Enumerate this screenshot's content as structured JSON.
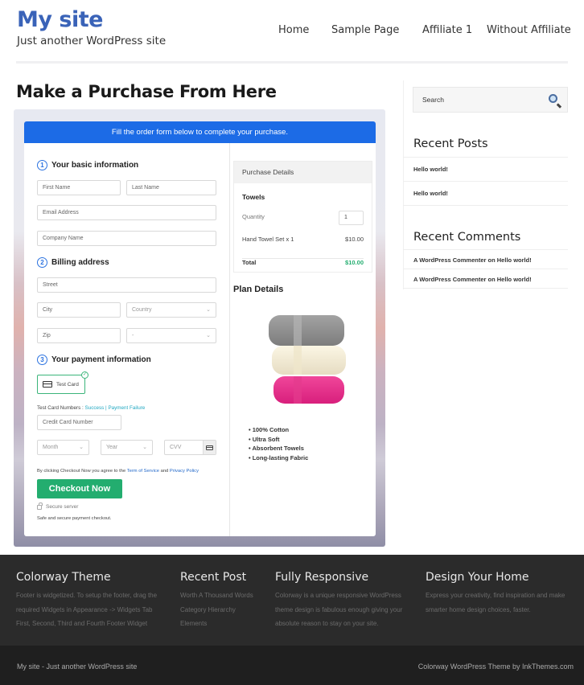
{
  "header": {
    "site_title": "My site",
    "tagline": "Just another WordPress site",
    "nav": [
      "Home",
      "Sample Page",
      "Affiliate 1",
      "Without Affiliate"
    ]
  },
  "page": {
    "title": "Make a Purchase From Here"
  },
  "form": {
    "banner": "Fill the order form below to complete your purchase.",
    "steps": [
      {
        "num": "1",
        "label": "Your basic information"
      },
      {
        "num": "2",
        "label": "Billing address"
      },
      {
        "num": "3",
        "label": "Your payment information"
      }
    ],
    "placeholders": {
      "first_name": "First Name",
      "last_name": "Last Name",
      "email": "Email Address",
      "company": "Company Name",
      "street": "Street",
      "city": "City",
      "country": "Country",
      "zip": "Zip",
      "state": "-",
      "card_number": "Credit Card Number",
      "month": "Month",
      "year": "Year",
      "cvv": "CVV"
    },
    "payment_method": "Test Card",
    "test_cards_label": "Test Card Numbers : ",
    "test_success": "Success",
    "test_sep": " | ",
    "test_failure": "Payment Failure",
    "agree_prefix": "By clicking Checkout Now you agree to the ",
    "terms_link": "Term of Service",
    "agree_and": " and ",
    "privacy_link": "Privacy Policy",
    "checkout_button": "Checkout Now",
    "secure_server": "Secure server",
    "safe_text": "Safe and secure payment checkout."
  },
  "purchase": {
    "header": "Purchase Details",
    "product": "Towels",
    "quantity_label": "Quantity",
    "quantity_value": "1",
    "line_item": "Hand Towel Set x 1",
    "line_price": "$10.00",
    "total_label": "Total",
    "total_value": "$10.00",
    "total_color": "#23ad6f",
    "plan_title": "Plan Details",
    "features": [
      "100% Cotton",
      "Ultra Soft",
      "Absorbent Towels",
      "Long-lasting Fabric"
    ]
  },
  "sidebar": {
    "search_placeholder": "Search",
    "recent_posts_title": "Recent Posts",
    "recent_posts": [
      "Hello world!",
      "Hello world!"
    ],
    "recent_comments_title": "Recent Comments",
    "recent_comments": [
      "A WordPress Commenter on Hello world!",
      "A WordPress Commenter on Hello world!"
    ]
  },
  "footer": {
    "columns": [
      {
        "title": "Colorway Theme",
        "lines": [
          "Footer is widgetized. To setup the footer, drag the",
          "required Widgets in Appearance -> Widgets Tab",
          "First, Second, Third and Fourth Footer Widget"
        ]
      },
      {
        "title": "Recent Post",
        "lines": [
          "Worth A Thousand Words",
          "Category Hierarchy",
          "Elements"
        ]
      },
      {
        "title": "Fully Responsive",
        "lines": [
          "Colorway is a unique responsive WordPress",
          "theme design is fabulous enough giving your",
          "absolute reason to stay on your site."
        ]
      },
      {
        "title": "Design Your Home",
        "lines": [
          "Express your creativity, find inspiration and make",
          "smarter home design choices, faster."
        ]
      }
    ],
    "bottom_left": "My site - Just another WordPress site",
    "bottom_right": "Colorway WordPress Theme by InkThemes.com"
  },
  "colors": {
    "brand": "#3a63b8",
    "banner": "#1c6be6",
    "checkout": "#23ad6f"
  }
}
